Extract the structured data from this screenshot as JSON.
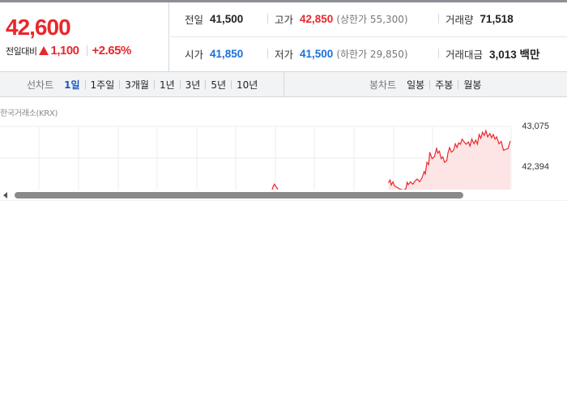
{
  "quote": {
    "price": "42,600",
    "change_label": "전일대비",
    "change_value": "1,100",
    "change_pct": "+2.65%",
    "direction": "up"
  },
  "stats": {
    "prev_close": {
      "label": "전일",
      "value": "41,500"
    },
    "high": {
      "label": "고가",
      "value": "42,850",
      "sub": "(상한가 55,300)"
    },
    "volume": {
      "label": "거래량",
      "value": "71,518"
    },
    "open": {
      "label": "시가",
      "value": "41,850"
    },
    "low": {
      "label": "저가",
      "value": "41,500",
      "sub": "(하한가 29,850)"
    },
    "amount": {
      "label": "거래대금",
      "value": "3,013 백만"
    }
  },
  "tabs": {
    "line_head": "선차트",
    "line_tabs": [
      "1일",
      "1주일",
      "3개월",
      "1년",
      "3년",
      "5년",
      "10년"
    ],
    "line_active": "1일",
    "candle_head": "봉차트",
    "candle_tabs": [
      "일봉",
      "주봉",
      "월봉"
    ]
  },
  "chart": {
    "exchange_label": "한국거래소(KRX)",
    "y_labels": [
      "43,075",
      "42,394"
    ]
  },
  "colors": {
    "up": "#e8282d",
    "down": "#1a6fd8",
    "active_tab": "#1a55c8",
    "fill": "#fde4e5"
  },
  "chart_data": {
    "type": "line",
    "title": "",
    "xlabel": "",
    "ylabel": "",
    "ylim": [
      41713,
      43075
    ],
    "y_ticks": [
      43075,
      42394
    ],
    "series": [
      {
        "values": [
          [
            0.685,
            41860
          ],
          [
            0.688,
            41920
          ],
          [
            0.69,
            41810
          ],
          [
            0.693,
            41880
          ],
          [
            0.696,
            41790
          ],
          [
            0.702,
            41750
          ],
          [
            0.706,
            41720
          ],
          [
            0.712,
            41700
          ],
          [
            0.716,
            41740
          ],
          [
            0.718,
            41870
          ],
          [
            0.72,
            41820
          ],
          [
            0.724,
            41880
          ],
          [
            0.728,
            41830
          ],
          [
            0.732,
            41900
          ],
          [
            0.736,
            41940
          ],
          [
            0.74,
            41880
          ],
          [
            0.744,
            41960
          ],
          [
            0.748,
            42100
          ],
          [
            0.75,
            42050
          ],
          [
            0.753,
            42300
          ],
          [
            0.756,
            42250
          ],
          [
            0.758,
            42520
          ],
          [
            0.76,
            42450
          ],
          [
            0.762,
            42380
          ],
          [
            0.766,
            42420
          ],
          [
            0.77,
            42600
          ],
          [
            0.772,
            42500
          ],
          [
            0.775,
            42540
          ],
          [
            0.778,
            42380
          ],
          [
            0.781,
            42420
          ],
          [
            0.784,
            42300
          ],
          [
            0.788,
            42340
          ],
          [
            0.79,
            42500
          ],
          [
            0.793,
            42620
          ],
          [
            0.796,
            42520
          ],
          [
            0.8,
            42560
          ],
          [
            0.803,
            42700
          ],
          [
            0.806,
            42620
          ],
          [
            0.809,
            42720
          ],
          [
            0.812,
            42690
          ],
          [
            0.815,
            42800
          ],
          [
            0.818,
            42750
          ],
          [
            0.822,
            42690
          ],
          [
            0.826,
            42740
          ],
          [
            0.829,
            42650
          ],
          [
            0.832,
            42800
          ],
          [
            0.836,
            42700
          ],
          [
            0.839,
            42780
          ],
          [
            0.842,
            42690
          ],
          [
            0.845,
            42900
          ],
          [
            0.848,
            42820
          ],
          [
            0.851,
            42950
          ],
          [
            0.854,
            42880
          ],
          [
            0.857,
            42980
          ],
          [
            0.86,
            42850
          ],
          [
            0.864,
            42920
          ],
          [
            0.867,
            42830
          ],
          [
            0.87,
            42900
          ],
          [
            0.873,
            42800
          ],
          [
            0.876,
            42850
          ],
          [
            0.88,
            42700
          ],
          [
            0.884,
            42750
          ],
          [
            0.888,
            42560
          ],
          [
            0.892,
            42580
          ],
          [
            0.896,
            42600
          ],
          [
            0.9,
            42760
          ]
        ]
      }
    ],
    "spike_values": [
      [
        0.48,
        41713
      ],
      [
        0.482,
        41790
      ],
      [
        0.484,
        41830
      ],
      [
        0.486,
        41790
      ],
      [
        0.488,
        41760
      ],
      [
        0.49,
        41713
      ]
    ]
  }
}
